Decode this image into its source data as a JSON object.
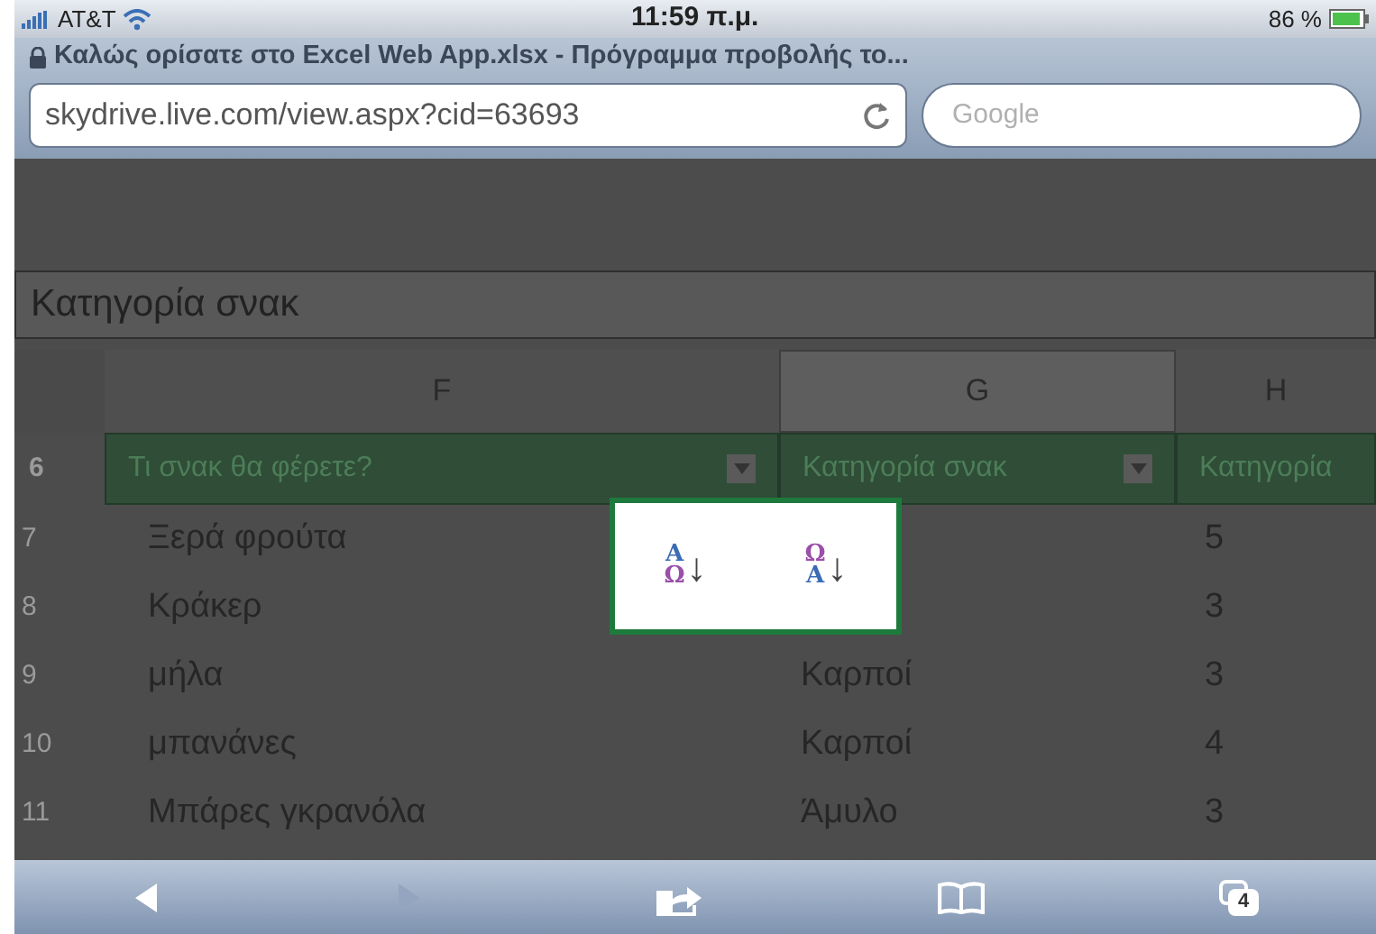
{
  "status_bar": {
    "carrier": "AT&T",
    "time": "11:59 π.μ.",
    "battery": "86 %"
  },
  "page_title": "Καλώς ορίσατε στο Excel Web App.xlsx - Πρόγραμμα προβολής το...",
  "address_field": {
    "value": "skydrive.live.com/view.aspx?cid=63693"
  },
  "search_field": {
    "placeholder": "Google"
  },
  "formula_bar": {
    "value": "Κατηγορία σνακ"
  },
  "columns": [
    {
      "label": "F",
      "selected": false
    },
    {
      "label": "G",
      "selected": true
    },
    {
      "label": "H",
      "selected": false
    }
  ],
  "header_row": {
    "number": "6",
    "cells": [
      "Τι σνακ θα φέρετε?",
      "Κατηγορία σνακ",
      "Κατηγορία"
    ]
  },
  "rows": [
    {
      "number": "7",
      "cells": [
        "Ξερά φρούτα",
        "",
        "5"
      ]
    },
    {
      "number": "8",
      "cells": [
        "Κράκερ",
        "",
        "3"
      ]
    },
    {
      "number": "9",
      "cells": [
        "μήλα",
        "Καρποί",
        "3"
      ]
    },
    {
      "number": "10",
      "cells": [
        "μπανάνες",
        "Καρποί",
        "4"
      ]
    },
    {
      "number": "11",
      "cells": [
        "Μπάρες γκρανόλα",
        "Άμυλο",
        "3"
      ]
    }
  ],
  "sort_menu": [
    {
      "top": "A",
      "bottom": "Ω",
      "arrow": "↓"
    },
    {
      "top": "Ω",
      "bottom": "A",
      "arrow": "↓"
    }
  ],
  "toolbar": {
    "back": {
      "disabled": false
    },
    "forward": {
      "disabled": true
    },
    "tab_count": "4"
  }
}
